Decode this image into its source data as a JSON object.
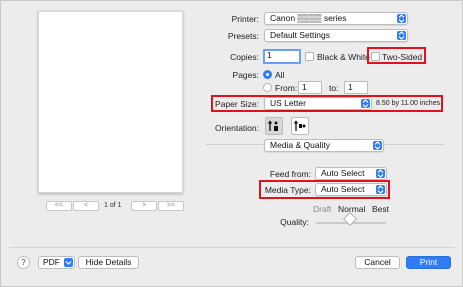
{
  "preview": {
    "page_indicator": "1 of 1",
    "first_label": "<<",
    "prev_label": "<",
    "next_label": ">",
    "last_label": ">>"
  },
  "printer": {
    "label": "Printer:",
    "value": "Canon ▒▒▒▒ series"
  },
  "presets": {
    "label": "Presets:",
    "value": "Default Settings"
  },
  "copies": {
    "label": "Copies:",
    "value": "1",
    "bw_label": "Black & White",
    "two_sided_label": "Two-Sided"
  },
  "pages": {
    "label": "Pages:",
    "all_label": "All",
    "from_label": "From:",
    "from_value": "1",
    "to_label": "to:",
    "to_value": "1"
  },
  "paper_size": {
    "label": "Paper Size:",
    "value": "US Letter",
    "dimensions": "8.50 by 11.00 inches"
  },
  "orientation": {
    "label": "Orientation:"
  },
  "section": {
    "value": "Media & Quality"
  },
  "feed_from": {
    "label": "Feed from:",
    "value": "Auto Select"
  },
  "media_type": {
    "label": "Media Type:",
    "value": "Auto Select"
  },
  "quality": {
    "label": "Quality:",
    "draft": "Draft",
    "normal": "Normal",
    "best": "Best"
  },
  "footer": {
    "help": "?",
    "pdf": "PDF",
    "hide_details": "Hide Details",
    "cancel": "Cancel",
    "print": "Print"
  },
  "colors": {
    "accent": "#2f7cf6",
    "highlight_box": "#e0121b",
    "background": "#ececec"
  }
}
